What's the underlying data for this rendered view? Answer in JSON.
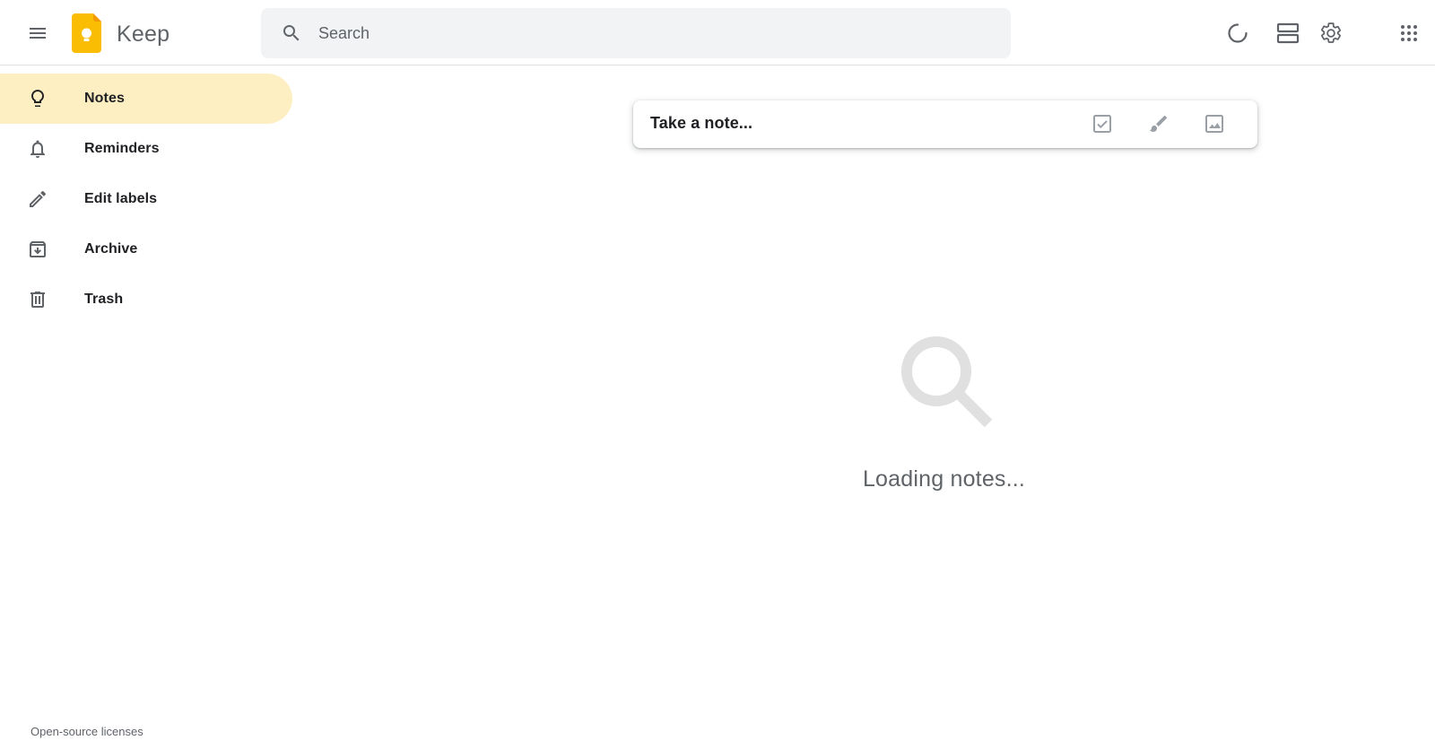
{
  "header": {
    "menu_icon": "hamburger-menu-icon",
    "logo_icon": "keep-logo",
    "app_title": "Keep",
    "search": {
      "icon": "search-icon",
      "placeholder": "Search",
      "value": ""
    },
    "actions": [
      {
        "name": "refresh-icon"
      },
      {
        "name": "list-view-icon"
      },
      {
        "name": "settings-gear-icon"
      },
      {
        "name": "apps-grid-icon"
      }
    ]
  },
  "sidebar": {
    "items": [
      {
        "label": "Notes",
        "icon": "lightbulb-icon",
        "active": true
      },
      {
        "label": "Reminders",
        "icon": "bell-icon",
        "active": false
      },
      {
        "label": "Edit labels",
        "icon": "pencil-icon",
        "active": false
      },
      {
        "label": "Archive",
        "icon": "archive-icon",
        "active": false
      },
      {
        "label": "Trash",
        "icon": "trash-icon",
        "active": false
      }
    ],
    "footer_link": "Open-source licenses"
  },
  "composer": {
    "placeholder": "Take a note...",
    "tools": [
      "checkbox-list-icon",
      "brush-icon",
      "image-icon"
    ]
  },
  "main": {
    "empty_icon": "search-icon",
    "status_text": "Loading notes..."
  },
  "colors": {
    "accent": "#fbbc04",
    "active_nav_bg": "#feefc3",
    "search_bg": "#f1f3f4",
    "icon_gray": "#5f6368"
  }
}
